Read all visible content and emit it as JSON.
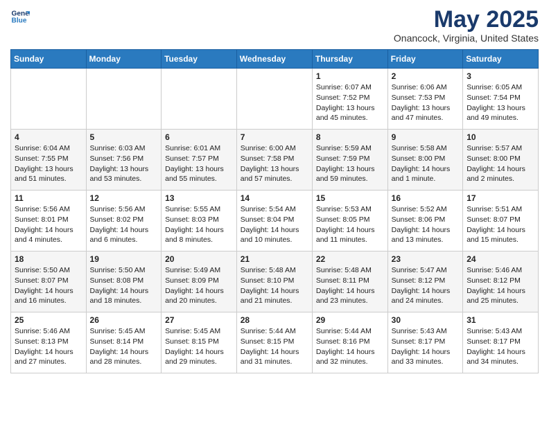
{
  "logo": {
    "line1": "General",
    "line2": "Blue"
  },
  "title": "May 2025",
  "location": "Onancock, Virginia, United States",
  "days_of_week": [
    "Sunday",
    "Monday",
    "Tuesday",
    "Wednesday",
    "Thursday",
    "Friday",
    "Saturday"
  ],
  "weeks": [
    [
      {
        "day": "",
        "info": ""
      },
      {
        "day": "",
        "info": ""
      },
      {
        "day": "",
        "info": ""
      },
      {
        "day": "",
        "info": ""
      },
      {
        "day": "1",
        "info": "Sunrise: 6:07 AM\nSunset: 7:52 PM\nDaylight: 13 hours\nand 45 minutes."
      },
      {
        "day": "2",
        "info": "Sunrise: 6:06 AM\nSunset: 7:53 PM\nDaylight: 13 hours\nand 47 minutes."
      },
      {
        "day": "3",
        "info": "Sunrise: 6:05 AM\nSunset: 7:54 PM\nDaylight: 13 hours\nand 49 minutes."
      }
    ],
    [
      {
        "day": "4",
        "info": "Sunrise: 6:04 AM\nSunset: 7:55 PM\nDaylight: 13 hours\nand 51 minutes."
      },
      {
        "day": "5",
        "info": "Sunrise: 6:03 AM\nSunset: 7:56 PM\nDaylight: 13 hours\nand 53 minutes."
      },
      {
        "day": "6",
        "info": "Sunrise: 6:01 AM\nSunset: 7:57 PM\nDaylight: 13 hours\nand 55 minutes."
      },
      {
        "day": "7",
        "info": "Sunrise: 6:00 AM\nSunset: 7:58 PM\nDaylight: 13 hours\nand 57 minutes."
      },
      {
        "day": "8",
        "info": "Sunrise: 5:59 AM\nSunset: 7:59 PM\nDaylight: 13 hours\nand 59 minutes."
      },
      {
        "day": "9",
        "info": "Sunrise: 5:58 AM\nSunset: 8:00 PM\nDaylight: 14 hours\nand 1 minute."
      },
      {
        "day": "10",
        "info": "Sunrise: 5:57 AM\nSunset: 8:00 PM\nDaylight: 14 hours\nand 2 minutes."
      }
    ],
    [
      {
        "day": "11",
        "info": "Sunrise: 5:56 AM\nSunset: 8:01 PM\nDaylight: 14 hours\nand 4 minutes."
      },
      {
        "day": "12",
        "info": "Sunrise: 5:56 AM\nSunset: 8:02 PM\nDaylight: 14 hours\nand 6 minutes."
      },
      {
        "day": "13",
        "info": "Sunrise: 5:55 AM\nSunset: 8:03 PM\nDaylight: 14 hours\nand 8 minutes."
      },
      {
        "day": "14",
        "info": "Sunrise: 5:54 AM\nSunset: 8:04 PM\nDaylight: 14 hours\nand 10 minutes."
      },
      {
        "day": "15",
        "info": "Sunrise: 5:53 AM\nSunset: 8:05 PM\nDaylight: 14 hours\nand 11 minutes."
      },
      {
        "day": "16",
        "info": "Sunrise: 5:52 AM\nSunset: 8:06 PM\nDaylight: 14 hours\nand 13 minutes."
      },
      {
        "day": "17",
        "info": "Sunrise: 5:51 AM\nSunset: 8:07 PM\nDaylight: 14 hours\nand 15 minutes."
      }
    ],
    [
      {
        "day": "18",
        "info": "Sunrise: 5:50 AM\nSunset: 8:07 PM\nDaylight: 14 hours\nand 16 minutes."
      },
      {
        "day": "19",
        "info": "Sunrise: 5:50 AM\nSunset: 8:08 PM\nDaylight: 14 hours\nand 18 minutes."
      },
      {
        "day": "20",
        "info": "Sunrise: 5:49 AM\nSunset: 8:09 PM\nDaylight: 14 hours\nand 20 minutes."
      },
      {
        "day": "21",
        "info": "Sunrise: 5:48 AM\nSunset: 8:10 PM\nDaylight: 14 hours\nand 21 minutes."
      },
      {
        "day": "22",
        "info": "Sunrise: 5:48 AM\nSunset: 8:11 PM\nDaylight: 14 hours\nand 23 minutes."
      },
      {
        "day": "23",
        "info": "Sunrise: 5:47 AM\nSunset: 8:12 PM\nDaylight: 14 hours\nand 24 minutes."
      },
      {
        "day": "24",
        "info": "Sunrise: 5:46 AM\nSunset: 8:12 PM\nDaylight: 14 hours\nand 25 minutes."
      }
    ],
    [
      {
        "day": "25",
        "info": "Sunrise: 5:46 AM\nSunset: 8:13 PM\nDaylight: 14 hours\nand 27 minutes."
      },
      {
        "day": "26",
        "info": "Sunrise: 5:45 AM\nSunset: 8:14 PM\nDaylight: 14 hours\nand 28 minutes."
      },
      {
        "day": "27",
        "info": "Sunrise: 5:45 AM\nSunset: 8:15 PM\nDaylight: 14 hours\nand 29 minutes."
      },
      {
        "day": "28",
        "info": "Sunrise: 5:44 AM\nSunset: 8:15 PM\nDaylight: 14 hours\nand 31 minutes."
      },
      {
        "day": "29",
        "info": "Sunrise: 5:44 AM\nSunset: 8:16 PM\nDaylight: 14 hours\nand 32 minutes."
      },
      {
        "day": "30",
        "info": "Sunrise: 5:43 AM\nSunset: 8:17 PM\nDaylight: 14 hours\nand 33 minutes."
      },
      {
        "day": "31",
        "info": "Sunrise: 5:43 AM\nSunset: 8:17 PM\nDaylight: 14 hours\nand 34 minutes."
      }
    ]
  ]
}
